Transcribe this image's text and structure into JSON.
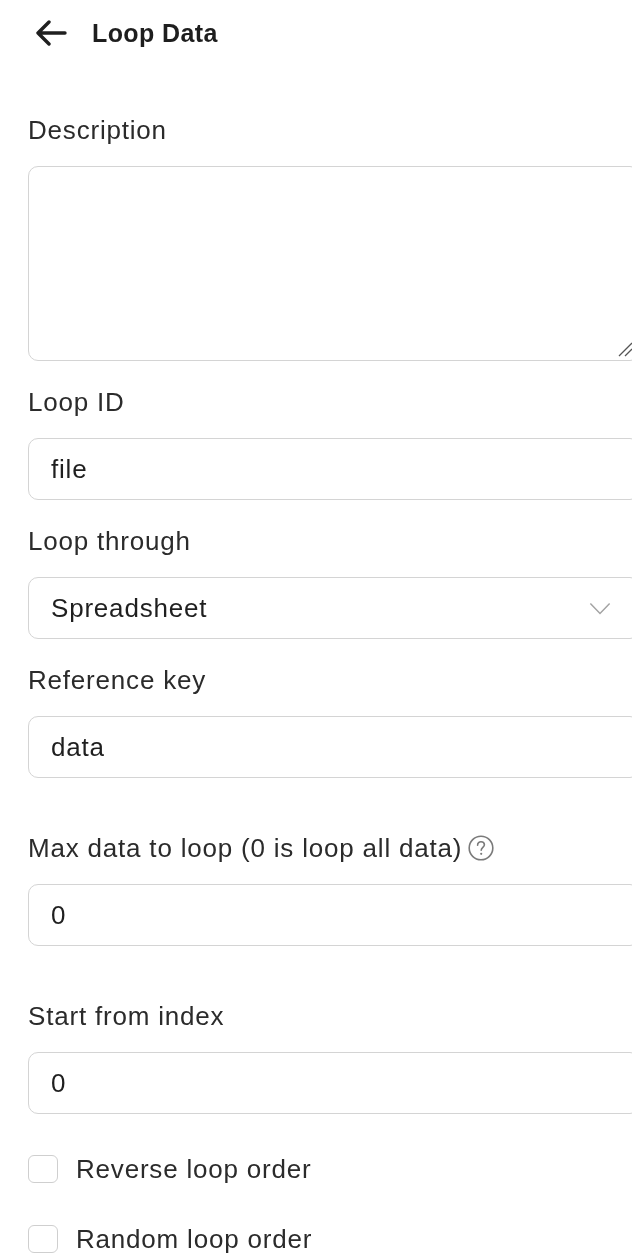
{
  "header": {
    "title": "Loop Data"
  },
  "fields": [
    {
      "kind": "textarea",
      "label": "Description"
    },
    {
      "kind": "text",
      "label": "Loop ID",
      "value": "file"
    },
    {
      "kind": "select",
      "label": "Loop through",
      "value": "Spreadsheet"
    },
    {
      "kind": "text",
      "label": "Reference key",
      "value": "data"
    },
    {
      "kind": "number",
      "label": "Max data to loop (0 is loop all data)",
      "value": "0",
      "help": true
    },
    {
      "kind": "number",
      "label": "Start from index",
      "value": "0"
    },
    {
      "kind": "checkbox",
      "label": "Reverse loop order",
      "checked": false
    },
    {
      "kind": "checkbox",
      "label": "Random loop order",
      "checked": false
    }
  ]
}
